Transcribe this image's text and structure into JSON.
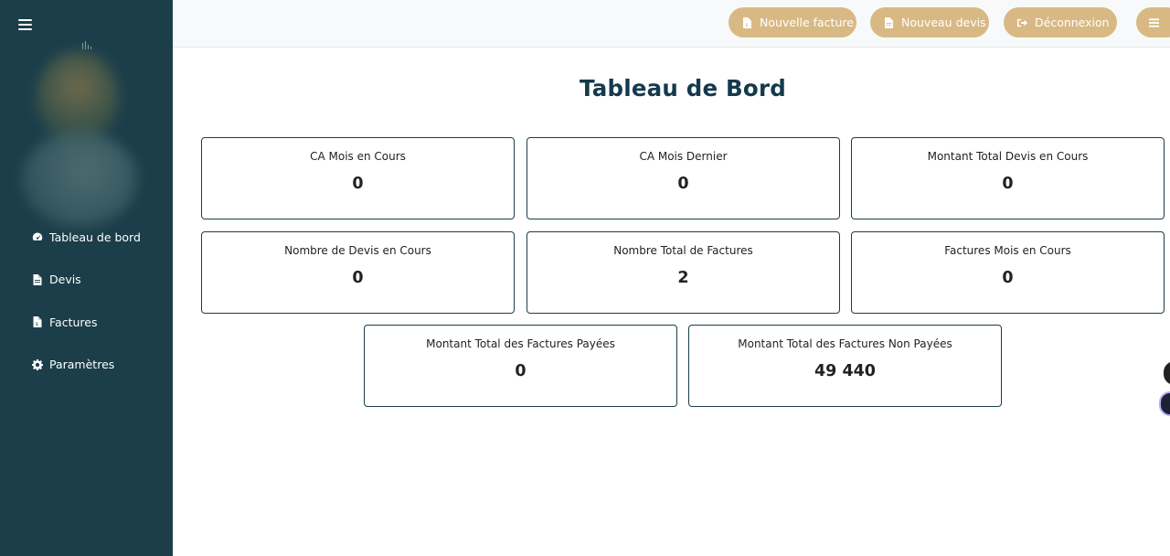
{
  "sidebar": {
    "menu_icon": "hamburger-icon",
    "items": [
      {
        "label": "Tableau de bord",
        "icon": "tachometer-icon"
      },
      {
        "label": "Devis",
        "icon": "file-icon"
      },
      {
        "label": "Factures",
        "icon": "invoice-icon"
      },
      {
        "label": "Paramètres",
        "icon": "gear-icon"
      }
    ]
  },
  "topbar": {
    "new_invoice_label": "Nouvelle facture",
    "new_quote_label": "Nouveau devis",
    "logout_label": "Déconnexion",
    "menu_icon": "bars-icon"
  },
  "page": {
    "title": "Tableau de Bord"
  },
  "cards": [
    {
      "label": "CA Mois en Cours",
      "value": "0"
    },
    {
      "label": "CA Mois Dernier",
      "value": "0"
    },
    {
      "label": "Montant Total Devis en Cours",
      "value": "0"
    },
    {
      "label": "Nombre de Devis en Cours",
      "value": "0"
    },
    {
      "label": "Nombre Total de Factures",
      "value": "2"
    },
    {
      "label": "Factures Mois en Cours",
      "value": "0"
    },
    {
      "label": "Montant Total des Factures Payées",
      "value": "0"
    },
    {
      "label": "Montant Total des Factures Non Payées",
      "value": "49 440"
    }
  ],
  "colors": {
    "sidebar_bg": "#1b3e4a",
    "accent_button": "#d9b983",
    "title": "#143a4c",
    "card_border": "#1b3e4a"
  }
}
